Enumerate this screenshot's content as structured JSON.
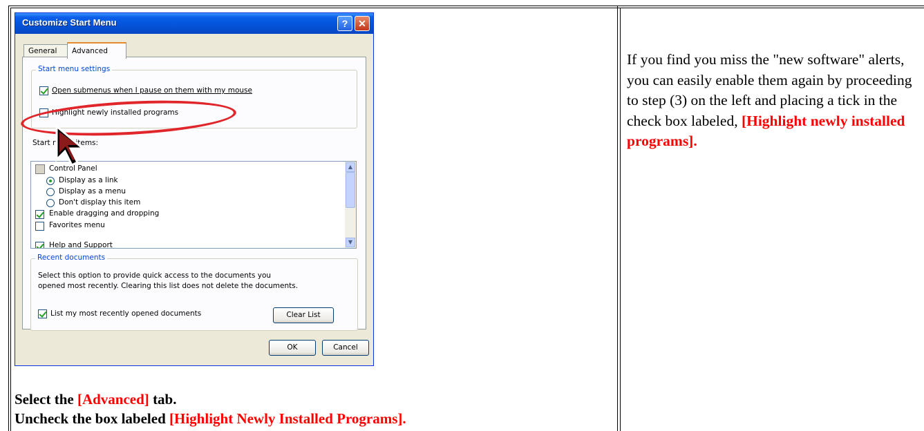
{
  "dialog": {
    "title": "Customize Start Menu",
    "help_btn": "?",
    "close_btn": "✕",
    "tabs": [
      "General",
      "Advanced"
    ],
    "start_settings": {
      "legend": "Start menu settings",
      "open_submenus": "Open submenus when I pause on them with my mouse",
      "highlight_new": "Highlight newly installed programs"
    },
    "items_label": "Start menu items:",
    "items": {
      "control_panel": "Control Panel",
      "display_link": "Display as a link",
      "display_menu": "Display as a menu",
      "dont_display": "Don't display this item",
      "enable_drag": "Enable dragging and dropping",
      "favorites": "Favorites menu",
      "help_support": "Help and Support"
    },
    "recent": {
      "legend": "Recent documents",
      "desc_line1": "Select this option to provide quick access to the documents you",
      "desc_line2": "opened most recently.  Clearing this list does not delete the documents.",
      "list_recent": "List my most recently opened documents",
      "clear_list": "Clear List"
    },
    "ok": "OK",
    "cancel": "Cancel"
  },
  "caption": {
    "line1_a": "Select the ",
    "line1_b": "[Advanced]",
    "line1_c": " tab.",
    "line2_a": "Uncheck the box labeled ",
    "line2_b": "[Highlight Newly Installed Programs]."
  },
  "right": {
    "text": "If you find you miss the \"new software\" alerts, you can easily enable them again by proceeding to step (3) on the left and placing a tick in the check box labeled, ",
    "highlight": "[Highlight newly installed programs]."
  },
  "colors": {
    "accent_red": "#ff0000",
    "xp_blue": "#0553d9"
  }
}
